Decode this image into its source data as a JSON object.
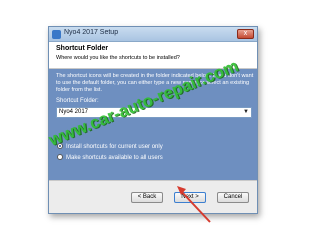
{
  "window": {
    "title": "Nyo4 2017 Setup",
    "close_glyph": "x"
  },
  "header": {
    "title": "Shortcut Folder",
    "subtitle": "Where would you like the shortcuts to be installed?"
  },
  "content": {
    "description": "The shortcut icons will be created in the folder indicated below. If you don't want to use the default folder, you can either type a new name, or select an existing folder from the list.",
    "folder_label": "Shortcut Folder:",
    "folder_value": "Nyo4 2017",
    "radio_options": [
      {
        "label": "Install shortcuts for current user only",
        "selected": true
      },
      {
        "label": "Make shortcuts available to all users",
        "selected": false
      }
    ]
  },
  "buttons": {
    "back": "< Back",
    "next": "Next >",
    "cancel": "Cancel"
  },
  "overlay": {
    "watermark": "www.car-auto-repair.com",
    "arrow_color": "#d63a2e",
    "watermark_color": "#2fbf2f"
  },
  "colors": {
    "content_bg": "#6e8fc0",
    "titlebar": "#a9c4e2"
  }
}
